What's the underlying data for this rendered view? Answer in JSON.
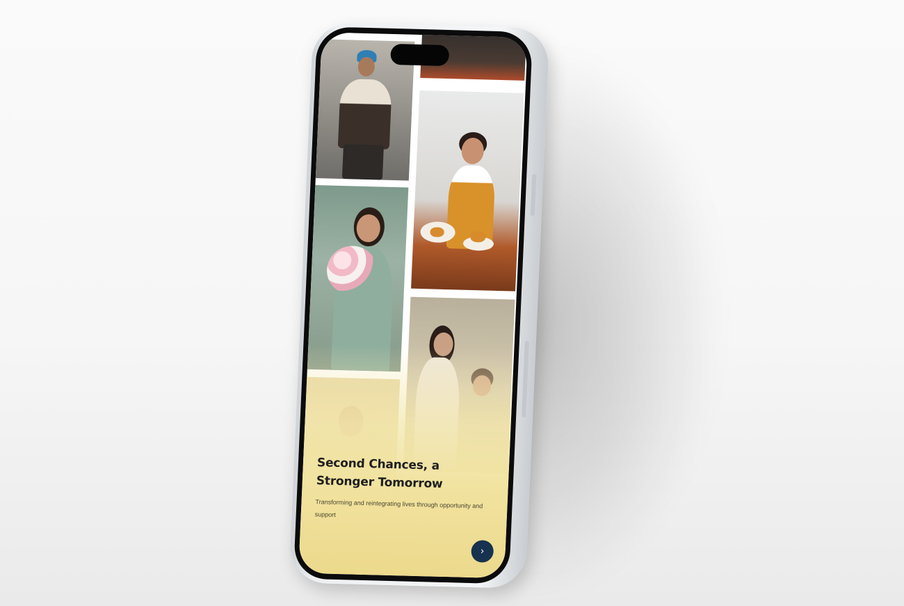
{
  "hero": {
    "title": "Second Chances, a Stronger Tomorrow",
    "subtitle": "Transforming and reintegrating lives through opportunity and support",
    "next_symbol": "›"
  },
  "icons": {
    "next": "chevron-right-icon"
  },
  "colors": {
    "accent_button": "#17324f",
    "fade_yellow": "#f1e3a0",
    "title_text": "#1f1f1f"
  }
}
